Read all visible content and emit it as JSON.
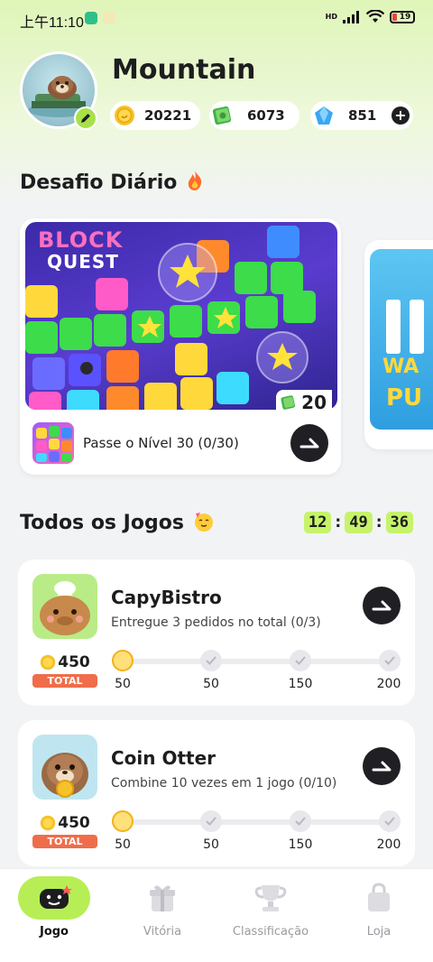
{
  "status_bar": {
    "time": "上午11:10",
    "network": "HD",
    "battery": "19"
  },
  "profile": {
    "username": "Mountain",
    "coins": "20221",
    "cash": "6073",
    "gems": "851"
  },
  "daily": {
    "title": "Desafio Diário",
    "game_logo_line1": "BLOCK",
    "game_logo_line2": "QUEST",
    "reward": "20",
    "task": "Passe o Nível 30 (0/30)",
    "peek_logo_line1": "WA",
    "peek_logo_line2": "PU"
  },
  "all_games": {
    "title": "Todos os Jogos",
    "timer": {
      "hours": "12",
      "minutes": "49",
      "seconds": "36"
    },
    "items": [
      {
        "name": "CapyBistro",
        "desc": "Entregue 3 pedidos no total (0/3)",
        "total": "450",
        "total_label": "TOTAL",
        "milestones": [
          "50",
          "50",
          "150",
          "200"
        ]
      },
      {
        "name": "Coin Otter",
        "desc": "Combine 10 vezes em 1 jogo (0/10)",
        "total": "450",
        "total_label": "TOTAL",
        "milestones": [
          "50",
          "50",
          "150",
          "200"
        ]
      }
    ]
  },
  "nav": {
    "items": [
      {
        "label": "Jogo",
        "icon": "gamepad-icon",
        "active": true
      },
      {
        "label": "Vitória",
        "icon": "gift-icon",
        "active": false
      },
      {
        "label": "Classificação",
        "icon": "trophy-icon",
        "active": false
      },
      {
        "label": "Loja",
        "icon": "shop-bag-icon",
        "active": false
      }
    ]
  },
  "colors": {
    "accent_green": "#b8ee55",
    "timer_green": "#c6f36a",
    "total_tag": "#ef6d4a",
    "dark_button": "#1f1f24"
  }
}
